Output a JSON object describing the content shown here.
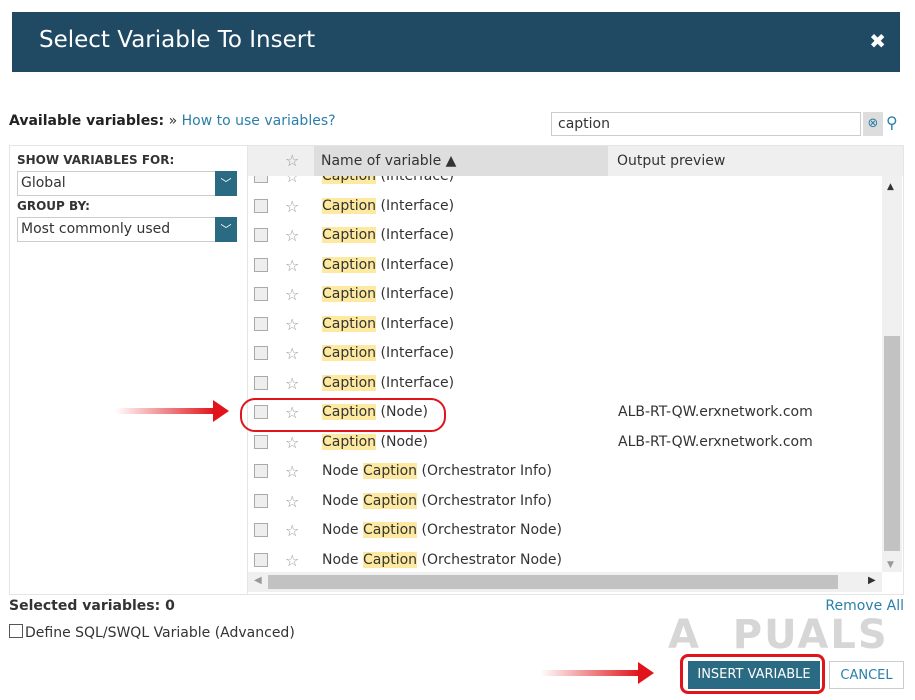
{
  "dialog": {
    "title": "Select Variable To Insert",
    "close": "✖"
  },
  "available_label": "Available variables:",
  "available_sep": "»",
  "how_to_link": "How to use variables?",
  "search": {
    "value": "caption"
  },
  "filters": {
    "show_label": "SHOW VARIABLES FOR:",
    "show_value": "Global",
    "group_label": "GROUP BY:",
    "group_value": "Most commonly used"
  },
  "table": {
    "col_name": "Name of variable ▲",
    "col_output": "Output preview",
    "rows": [
      {
        "pre": "",
        "hl": "Caption",
        "post": " (Interface)",
        "output": ""
      },
      {
        "pre": "",
        "hl": "Caption",
        "post": " (Interface)",
        "output": ""
      },
      {
        "pre": "",
        "hl": "Caption",
        "post": " (Interface)",
        "output": ""
      },
      {
        "pre": "",
        "hl": "Caption",
        "post": " (Interface)",
        "output": ""
      },
      {
        "pre": "",
        "hl": "Caption",
        "post": " (Interface)",
        "output": ""
      },
      {
        "pre": "",
        "hl": "Caption",
        "post": " (Interface)",
        "output": ""
      },
      {
        "pre": "",
        "hl": "Caption",
        "post": " (Interface)",
        "output": ""
      },
      {
        "pre": "",
        "hl": "Caption",
        "post": " (Interface)",
        "output": ""
      },
      {
        "pre": "",
        "hl": "Caption",
        "post": " (Node)",
        "output": "ALB-RT-QW.erxnetwork.com"
      },
      {
        "pre": "",
        "hl": "Caption",
        "post": " (Node)",
        "output": "ALB-RT-QW.erxnetwork.com"
      },
      {
        "pre": "Node ",
        "hl": "Caption",
        "post": " (Orchestrator Info)",
        "output": ""
      },
      {
        "pre": "Node ",
        "hl": "Caption",
        "post": " (Orchestrator Info)",
        "output": ""
      },
      {
        "pre": "Node ",
        "hl": "Caption",
        "post": " (Orchestrator Node)",
        "output": ""
      },
      {
        "pre": "Node ",
        "hl": "Caption",
        "post": " (Orchestrator Node)",
        "output": ""
      }
    ]
  },
  "footer": {
    "selected": "Selected variables: 0",
    "remove_all": "Remove All",
    "sql": "Define SQL/SWQL Variable (Advanced)",
    "insert": "INSERT VARIABLE",
    "cancel": "CANCEL"
  },
  "watermark": "APPUALS"
}
